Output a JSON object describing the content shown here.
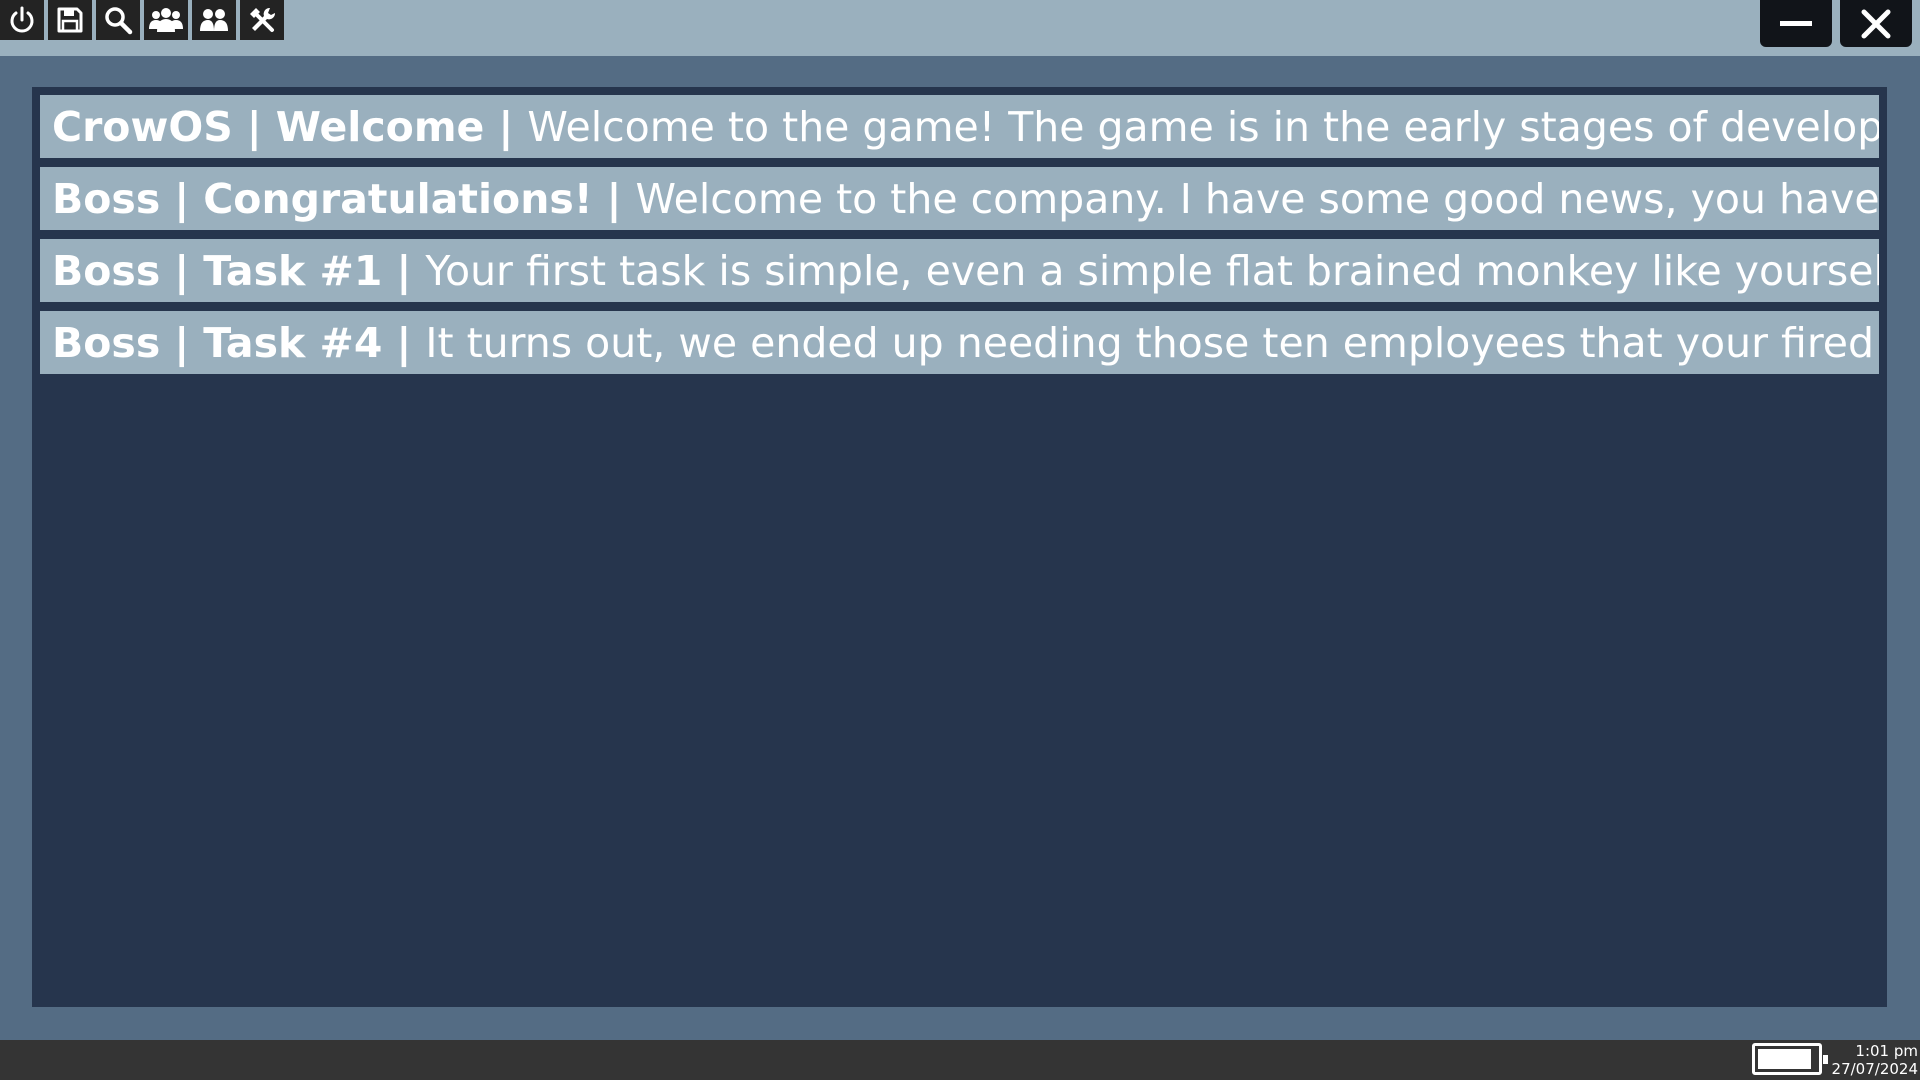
{
  "window": {
    "minimize_icon": "minimize-icon",
    "close_icon": "close-icon"
  },
  "mail": {
    "items": [
      {
        "sender": "CrowOS",
        "separator1": "|",
        "subject": "Welcome",
        "separator2": "|",
        "preview": "Welcome to the game! The game is in the early stages of development"
      },
      {
        "sender": "Boss",
        "separator1": "|",
        "subject": "Congratulations!",
        "separator2": "|",
        "preview": "Welcome to the company. I have some good news, you have been"
      },
      {
        "sender": "Boss",
        "separator1": "|",
        "subject": "Task #1",
        "separator2": "|",
        "preview": "Your first task is simple, even a simple flat brained monkey like yourself car"
      },
      {
        "sender": "Boss",
        "separator1": "|",
        "subject": "Task #4",
        "separator2": "|",
        "preview": "It turns out, we ended up needing those ten employees that your fired earl"
      }
    ]
  },
  "taskbar": {
    "icons": [
      "power-icon",
      "save-icon",
      "search-icon",
      "group-icon",
      "users-icon",
      "tools-icon"
    ],
    "battery_level": 0.92,
    "time": "1:01 pm",
    "date": "27/07/2024"
  },
  "colors": {
    "background": "#546c84",
    "titlebar": "#9ab0be",
    "panel": "#26354d",
    "row": "#9ab0be",
    "taskbar": "#343434"
  }
}
